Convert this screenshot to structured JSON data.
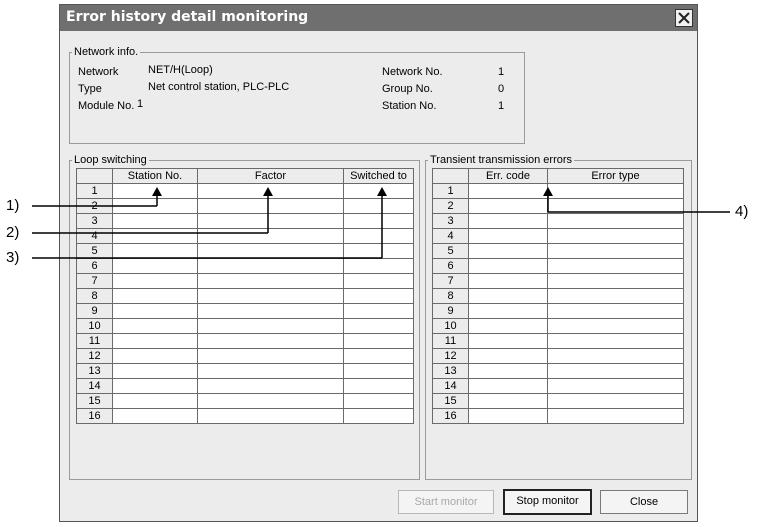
{
  "window": {
    "title": "Error history detail monitoring"
  },
  "network_info": {
    "legend": "Network info.",
    "network_label": "Network",
    "network_value": "NET/H(Loop)",
    "type_label": "Type",
    "type_value": "Net control station, PLC-PLC",
    "module_label": "Module No.",
    "module_value": "1",
    "network_no_label": "Network No.",
    "network_no_value": "1",
    "group_no_label": "Group No.",
    "group_no_value": "0",
    "station_no_label": "Station No.",
    "station_no_value": "1"
  },
  "loop_switching": {
    "legend": "Loop switching",
    "columns": [
      "",
      "Station No.",
      "Factor",
      "Switched to"
    ],
    "rows": [
      "1",
      "2",
      "3",
      "4",
      "5",
      "6",
      "7",
      "8",
      "9",
      "10",
      "11",
      "12",
      "13",
      "14",
      "15",
      "16"
    ]
  },
  "transient_errors": {
    "legend": "Transient transmission errors",
    "columns": [
      "",
      "Err. code",
      "Error type"
    ],
    "rows": [
      "1",
      "2",
      "3",
      "4",
      "5",
      "6",
      "7",
      "8",
      "9",
      "10",
      "11",
      "12",
      "13",
      "14",
      "15",
      "16"
    ]
  },
  "buttons": {
    "start_monitor": "Start monitor",
    "stop_monitor": "Stop monitor",
    "close": "Close"
  },
  "callouts": [
    "1)",
    "2)",
    "3)",
    "4)"
  ]
}
